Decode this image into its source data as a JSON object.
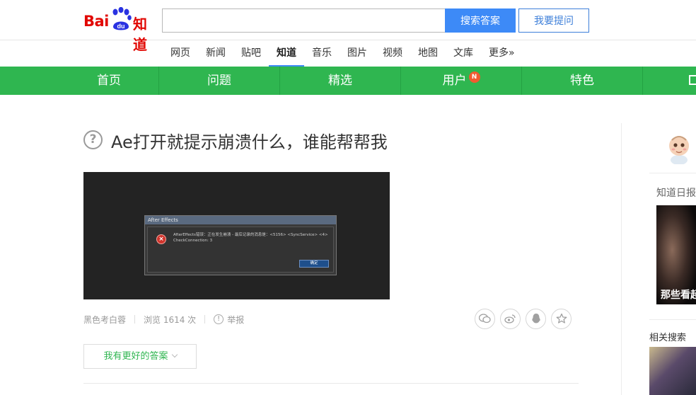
{
  "header": {
    "logo_bai": "Bai",
    "logo_du": "du",
    "logo_zhidao": "知道",
    "search_value": "",
    "search_button": "搜索答案",
    "ask_button": "我要提问"
  },
  "channels": [
    "网页",
    "新闻",
    "贴吧",
    "知道",
    "音乐",
    "图片",
    "视频",
    "地图",
    "文库",
    "更多»"
  ],
  "active_channel": "知道",
  "menu": {
    "items": [
      "首页",
      "问题",
      "精选",
      "用户",
      "特色"
    ],
    "user_badge": "N",
    "bar_color": "#2fb650"
  },
  "question": {
    "icon": "question-circle-icon",
    "title": "Ae打开就提示崩溃什么，谁能帮帮我",
    "image": {
      "dialog_title": "After Effects",
      "dialog_message": "AfterEffects错误：正在发生崩溃 - 最后记录的消息是：<5156> <SyncService> <4> CheckConnection: 3",
      "ok_label": "确定"
    },
    "author": "黑色考白蓉",
    "views_label": "浏览 1614 次",
    "report_label": "举报",
    "share_icons": [
      "wechat-icon",
      "weibo-icon",
      "qq-icon",
      "favorite-star-icon"
    ],
    "better_answer_button": "我有更好的答案"
  },
  "sidebar": {
    "daily_label": "知道日报",
    "daily_caption": "那些看起",
    "related_label": "相关搜索"
  }
}
